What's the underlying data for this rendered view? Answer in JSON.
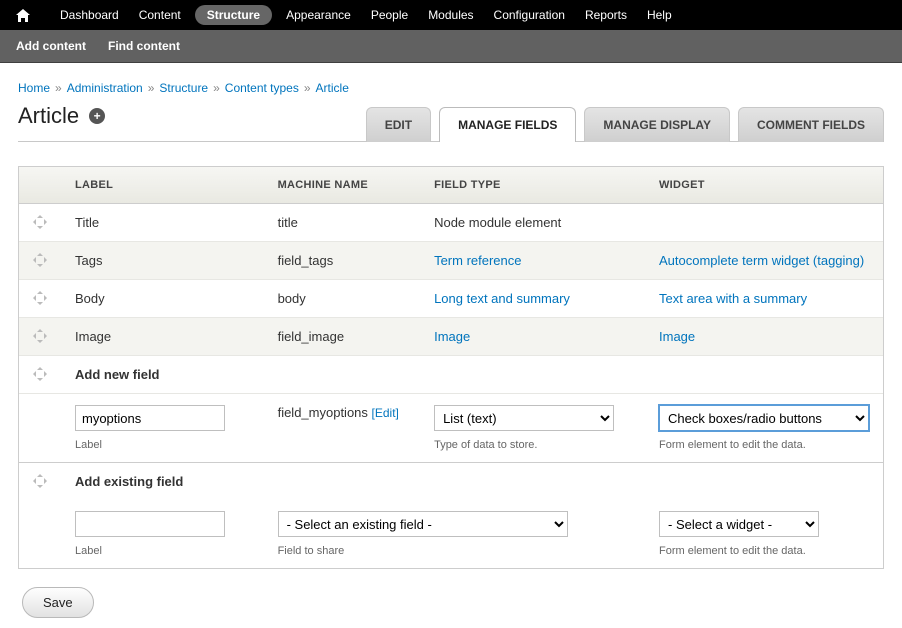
{
  "topnav": {
    "items": [
      "Dashboard",
      "Content",
      "Structure",
      "Appearance",
      "People",
      "Modules",
      "Configuration",
      "Reports",
      "Help"
    ],
    "active_index": 2
  },
  "subnav": {
    "items": [
      "Add content",
      "Find content"
    ]
  },
  "breadcrumb": [
    "Home",
    "Administration",
    "Structure",
    "Content types",
    "Article"
  ],
  "page_title": "Article",
  "tabs": {
    "items": [
      "EDIT",
      "MANAGE FIELDS",
      "MANAGE DISPLAY",
      "COMMENT FIELDS"
    ],
    "active_index": 1
  },
  "table": {
    "headers": [
      "LABEL",
      "MACHINE NAME",
      "FIELD TYPE",
      "WIDGET"
    ],
    "rows": [
      {
        "label": "Title",
        "machine": "title",
        "type": "Node module element",
        "type_link": false,
        "widget": "",
        "widget_link": false
      },
      {
        "label": "Tags",
        "machine": "field_tags",
        "type": "Term reference",
        "type_link": true,
        "widget": "Autocomplete term widget (tagging)",
        "widget_link": true
      },
      {
        "label": "Body",
        "machine": "body",
        "type": "Long text and summary",
        "type_link": true,
        "widget": "Text area with a summary",
        "widget_link": true
      },
      {
        "label": "Image",
        "machine": "field_image",
        "type": "Image",
        "type_link": true,
        "widget": "Image",
        "widget_link": true
      }
    ]
  },
  "add_new": {
    "section_label": "Add new field",
    "label_value": "myoptions",
    "label_help": "Label",
    "machine_name": "field_myoptions",
    "machine_edit": "[Edit]",
    "type_value": "List (text)",
    "type_help": "Type of data to store.",
    "widget_value": "Check boxes/radio buttons",
    "widget_help": "Form element to edit the data."
  },
  "add_existing": {
    "section_label": "Add existing field",
    "label_value": "",
    "label_help": "Label",
    "field_value": "- Select an existing field -",
    "field_help": "Field to share",
    "widget_value": "- Select a widget -",
    "widget_help": "Form element to edit the data."
  },
  "save_label": "Save"
}
